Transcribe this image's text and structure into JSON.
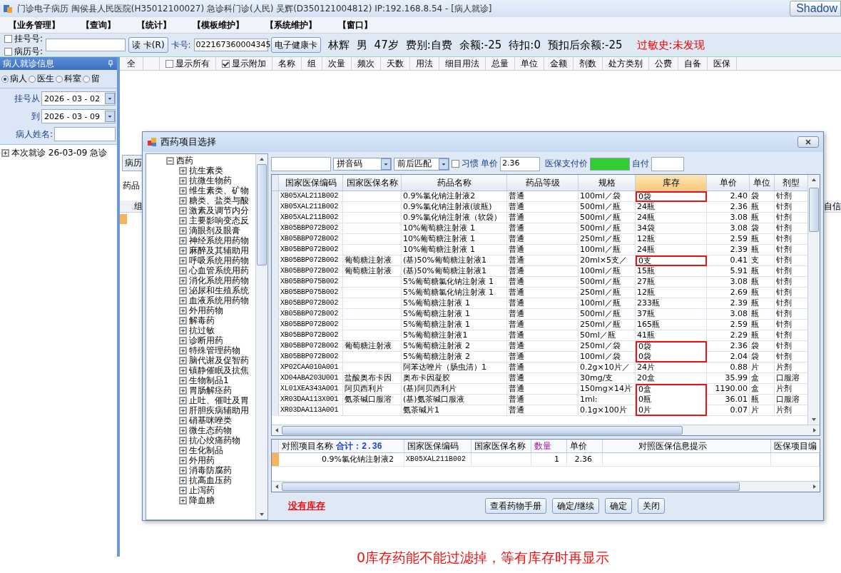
{
  "window": {
    "title": "门诊电子病历  闽侯县人民医院(H35012100027)  急诊科门诊(人民)  吴辉(D350121004812) IP:192.168.8.54 - [病人就诊]",
    "corner_button": "Shadow"
  },
  "menu": [
    "【业务管理】",
    "【查询】",
    "【统计】",
    "【模板维护】",
    "【系统维护】",
    "【窗口】"
  ],
  "patient_bar": {
    "id_options": [
      {
        "label": "挂号号:",
        "checked": false
      },
      {
        "label": "病历号:",
        "checked": false
      }
    ],
    "read_card_button": "读 卡(R)",
    "card_label": "卡号:",
    "card_number": "022167360004345",
    "health_card_button": "电子健康卡",
    "info": [
      "林辉",
      "男",
      "47岁",
      "费别:自费",
      "余额:-25",
      "待扣:0",
      "预扣后余额:-25"
    ],
    "allergy": "过敏史:未发现"
  },
  "left_panel": {
    "title": "病人就诊信息",
    "radios": [
      {
        "label": "病人",
        "selected": true
      },
      {
        "label": "医生",
        "selected": false
      },
      {
        "label": "科室",
        "selected": false
      },
      {
        "label": "留",
        "selected": false
      }
    ],
    "date_from_label": "挂号从",
    "date_from": "2026 - 03 - 02",
    "date_to_label": "到",
    "date_to": "2026 - 03 - 09",
    "name_label": "病人姓名:",
    "visits": [
      {
        "label": "本次就诊  26-03-09 急诊",
        "expanded": false
      }
    ]
  },
  "main_grid": {
    "first_column": "全",
    "toggles": [
      {
        "label": "显示所有",
        "checked": false
      },
      {
        "label": "显示附加",
        "checked": true
      }
    ],
    "columns": [
      "名称",
      "组",
      "次量",
      "频次",
      "天数",
      "用法",
      "细目用法",
      "总量",
      "单位",
      "金额",
      "剂数",
      "处方类别",
      "公费",
      "自备",
      "医保"
    ],
    "tab": "病历",
    "section_label": "药品",
    "sub_columns": [
      "组",
      "自信"
    ]
  },
  "dialog": {
    "title": "西药项目选择",
    "tree": [
      {
        "label": "西药",
        "expanded": true,
        "children": [
          {
            "label": "抗生素类",
            "expanded": false
          },
          {
            "label": "抗微生物药",
            "expanded": false
          },
          {
            "label": "维生素类、矿物",
            "expanded": false
          },
          {
            "label": "糖类、盐类与酸",
            "expanded": false
          },
          {
            "label": "激素及调节内分",
            "expanded": false
          },
          {
            "label": "主要影响变态反",
            "expanded": false
          },
          {
            "label": "滴眼剂及眼膏",
            "expanded": false
          },
          {
            "label": "神经系统用药物",
            "expanded": false
          },
          {
            "label": "麻醉及其辅助用",
            "expanded": false
          },
          {
            "label": "呼吸系统用药物",
            "expanded": false
          },
          {
            "label": "心血管系统用药",
            "expanded": false
          },
          {
            "label": "消化系统用药物",
            "expanded": false
          },
          {
            "label": "泌尿和生殖系统",
            "expanded": false
          },
          {
            "label": "血液系统用药物",
            "expanded": false
          },
          {
            "label": "外用药物",
            "expanded": false
          },
          {
            "label": "解毒药",
            "expanded": false
          },
          {
            "label": "抗过敏",
            "expanded": false
          },
          {
            "label": "诊断用药",
            "expanded": false
          },
          {
            "label": "特殊管理药物",
            "expanded": false
          },
          {
            "label": "脑代谢及促智药",
            "expanded": false
          },
          {
            "label": "镇静催眠及抗焦",
            "expanded": false
          },
          {
            "label": "生物制品1",
            "expanded": false
          },
          {
            "label": "胃肠解痉药",
            "expanded": false
          },
          {
            "label": "止吐、催吐及胃",
            "expanded": false
          },
          {
            "label": "肝胆疾病辅助用",
            "expanded": false
          },
          {
            "label": "硝基咪唑类",
            "expanded": false
          },
          {
            "label": "微生态药物",
            "expanded": false
          },
          {
            "label": "抗心绞痛药物",
            "expanded": false
          },
          {
            "label": "生化制品",
            "expanded": false
          },
          {
            "label": "外用药",
            "expanded": false
          },
          {
            "label": "消毒防腐药",
            "expanded": false
          },
          {
            "label": "抗高血压药",
            "expanded": false
          },
          {
            "label": "止泻药",
            "expanded": false
          },
          {
            "label": "降血糖",
            "expanded": false
          }
        ]
      }
    ],
    "search": {
      "mode": "拼音码",
      "match": "前后匹配",
      "habit": {
        "label": "习惯",
        "checked": false
      },
      "price_label": "单价",
      "price": "2.36",
      "insurance_price_label": "医保支付价",
      "self_pay_label": "自付"
    },
    "columns": [
      {
        "label": "国家医保编码",
        "selected": false
      },
      {
        "label": "国家医保名称",
        "selected": false
      },
      {
        "label": "药品名称",
        "selected": false
      },
      {
        "label": "药品等级",
        "selected": false
      },
      {
        "label": "规格",
        "selected": false
      },
      {
        "label": "库存",
        "selected": true
      },
      {
        "label": "单价",
        "selected": false
      },
      {
        "label": "单位",
        "selected": false
      },
      {
        "label": "剂型",
        "selected": false
      }
    ],
    "rows": [
      {
        "code": "XB05XAL211B002",
        "name": "0.9%氯化钠注射液2",
        "grade": "普通",
        "spec": "100ml／袋",
        "stock": "0袋",
        "price": "2.40",
        "unit": "袋",
        "form": "针剂",
        "flagged": true
      },
      {
        "code": "XB05XAL211B002",
        "name": "0.9%氯化钠注射液(玻瓶)",
        "grade": "普通",
        "spec": "500ml／瓶",
        "stock": "24瓶",
        "price": "2.36",
        "unit": "瓶",
        "form": "针剂",
        "flagged": false
      },
      {
        "code": "XB05XAL211B002",
        "name": "0.9%氯化钠注射液（软袋）",
        "grade": "普通",
        "spec": "500ml／瓶",
        "stock": "24瓶",
        "price": "3.08",
        "unit": "瓶",
        "form": "针剂",
        "flagged": false
      },
      {
        "code": "XB05BBP072B002",
        "name": "10%葡萄糖注射液 1",
        "grade": "普通",
        "spec": "500ml／瓶",
        "stock": "34袋",
        "price": "3.08",
        "unit": "袋",
        "form": "针剂",
        "flagged": false
      },
      {
        "code": "XB05BBP072B002",
        "name": "10%葡萄糖注射液 1",
        "grade": "普通",
        "spec": "250ml／瓶",
        "stock": "12瓶",
        "price": "2.59",
        "unit": "瓶",
        "form": "针剂",
        "flagged": false
      },
      {
        "code": "XB05BBP072B002",
        "name": "10%葡萄糖注射液 1",
        "grade": "普通",
        "spec": "100ml／瓶",
        "stock": "24瓶",
        "price": "2.39",
        "unit": "瓶",
        "form": "针剂",
        "flagged": false
      },
      {
        "code": "XB05BBP072B002",
        "insurance_name": "葡萄糖注射液",
        "name": "(基)50%葡萄糖注射液1",
        "grade": "普通",
        "spec": "20ml×5支／",
        "stock": "0支",
        "price": "0.41",
        "unit": "支",
        "form": "针剂",
        "flagged": true
      },
      {
        "code": "XB05BBP072B002",
        "insurance_name": "葡萄糖注射液",
        "name": "(基)50%葡萄糖注射液1",
        "grade": "普通",
        "spec": "100ml／瓶",
        "stock": "15瓶",
        "price": "5.91",
        "unit": "瓶",
        "form": "针剂",
        "flagged": false
      },
      {
        "code": "XB05BBP075B002",
        "name": "5%葡萄糖氯化钠注射液 1",
        "grade": "普通",
        "spec": "500ml／瓶",
        "stock": "27瓶",
        "price": "3.08",
        "unit": "瓶",
        "form": "针剂",
        "flagged": false
      },
      {
        "code": "XB05BBP075B002",
        "name": "5%葡萄糖氯化钠注射液 1",
        "grade": "普通",
        "spec": "250ml／瓶",
        "stock": "12瓶",
        "price": "2.69",
        "unit": "瓶",
        "form": "针剂",
        "flagged": false
      },
      {
        "code": "XB05BBP072B002",
        "name": "5%葡萄糖注射液 1",
        "grade": "普通",
        "spec": "100ml／瓶",
        "stock": "233瓶",
        "price": "2.39",
        "unit": "瓶",
        "form": "针剂",
        "flagged": false
      },
      {
        "code": "XB05BBP072B002",
        "name": "5%葡萄糖注射液 1",
        "grade": "普通",
        "spec": "500ml／瓶",
        "stock": "37瓶",
        "price": "3.08",
        "unit": "瓶",
        "form": "针剂",
        "flagged": false
      },
      {
        "code": "XB05BBP072B002",
        "name": "5%葡萄糖注射液 1",
        "grade": "普通",
        "spec": "250ml／瓶",
        "stock": "165瓶",
        "price": "2.59",
        "unit": "瓶",
        "form": "针剂",
        "flagged": false
      },
      {
        "code": "XB05BBP072B002",
        "name": "5%葡萄糖注射液1",
        "grade": "普通",
        "spec": "50ml／瓶",
        "stock": "41瓶",
        "price": "2.29",
        "unit": "瓶",
        "form": "针剂",
        "flagged": false
      },
      {
        "code": "XB05BBP072B002",
        "insurance_name": "葡萄糖注射液",
        "name": "5%葡萄糖注射液 2",
        "grade": "普通",
        "spec": "250ml／袋",
        "stock": "0袋",
        "price": "2.36",
        "unit": "袋",
        "form": "针剂",
        "flagged": true
      },
      {
        "code": "XB05BBP072B002",
        "name": "5%葡萄糖注射液 2",
        "grade": "普通",
        "spec": "100ml／袋",
        "stock": "0袋",
        "price": "2.04",
        "unit": "袋",
        "form": "针剂",
        "flagged": true
      },
      {
        "code": "XP02CAA010A001",
        "name": "阿苯达唑片（肠虫清）1",
        "grade": "普通",
        "spec": "0.2g×10片／",
        "stock": "24片",
        "price": "0.88",
        "unit": "片",
        "form": "片剂",
        "flagged": false
      },
      {
        "code": "XD04ABA203U001",
        "insurance_name": "盐酸奥布卡因",
        "name": "奥布卡因凝胶",
        "grade": "普通",
        "spec": "30mg/支",
        "stock": "20盒",
        "price": "35.99",
        "unit": "盒",
        "form": "口服溶",
        "flagged": false
      },
      {
        "code": "XL01XEA343A001",
        "insurance_name": "阿贝西利片",
        "name": "(基)阿贝西利片",
        "grade": "普通",
        "spec": "150mg×14片",
        "stock": "0盒",
        "price": "1190.00",
        "unit": "盒",
        "form": "片剂",
        "flagged": true
      },
      {
        "code": "XR03DAA113X001",
        "insurance_name": "氨茶碱口服溶",
        "name": "(基)氨茶碱口服液",
        "grade": "普通",
        "spec": "1ml:",
        "stock": "0瓶",
        "price": "36.01",
        "unit": "瓶",
        "form": "口服溶",
        "flagged": true
      },
      {
        "code": "XR03DAA113A001",
        "name": "氨茶碱片1",
        "grade": "普通",
        "spec": "0.1g×100片",
        "stock": "0片",
        "price": "0.07",
        "unit": "片",
        "form": "片剂",
        "flagged": true
      }
    ],
    "selection": {
      "columns": [
        "对照项目名称",
        "国家医保编码",
        "国家医保名称",
        "数量",
        "单价",
        "对照医保信息提示",
        "医保项目编"
      ],
      "total": "合计：2.36",
      "rows": [
        {
          "name": "0.9%氯化钠注射液2",
          "code": "XB05XAL211B002",
          "quantity": "1",
          "price": "2.36"
        }
      ]
    },
    "footer": {
      "warning": "没有库存",
      "buttons": [
        "查看药物手册",
        "确定/继续",
        "确定",
        "关闭"
      ]
    }
  },
  "annotation": "0库存药能不能过滤掉，等有库存时再显示"
}
